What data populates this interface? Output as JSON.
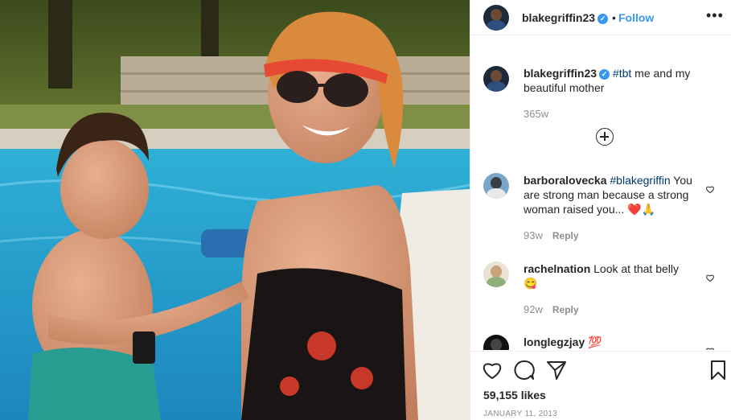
{
  "post": {
    "username": "blakegriffin23",
    "separator": "•",
    "follow_label": "Follow",
    "more_label": "•••",
    "verified_mark": "✓",
    "caption_text": "me and my beautiful mother",
    "caption_hashtag": "#tbt",
    "caption_time": "365w",
    "likes": "59,155 likes",
    "date": "JANUARY 11, 2013"
  },
  "comments": [
    {
      "username": "barboralovecka",
      "hashtag": "#blakegriffin",
      "text": "You are strong man because a strong woman raised you...",
      "emoji": "❤️🙏",
      "time": "93w",
      "reply_label": "Reply"
    },
    {
      "username": "rachelnation",
      "text": "Look at that belly",
      "emoji": "😋",
      "time": "92w",
      "reply_label": "Reply"
    },
    {
      "username": "longlegzjay",
      "emoji": "💯"
    }
  ],
  "icons": {
    "like": "heart-icon",
    "comment": "comment-icon",
    "share": "paper-plane-icon",
    "save": "bookmark-icon",
    "load_more": "plus-circle-icon"
  },
  "colors": {
    "link_blue": "#3897f0",
    "text": "#262626",
    "muted": "#8e8e8e"
  }
}
